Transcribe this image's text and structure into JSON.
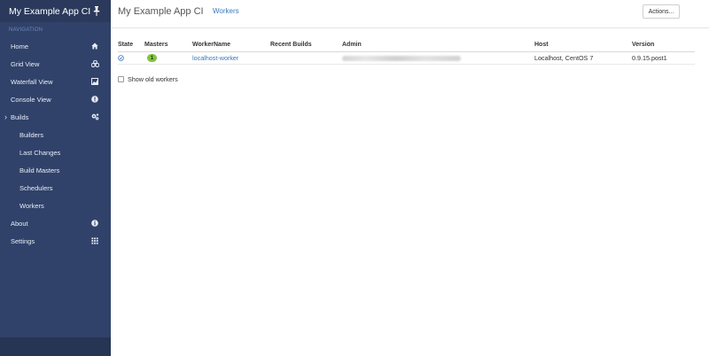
{
  "app": {
    "title": "My Example App CI"
  },
  "sidebar": {
    "section_label": "NAVIGATION",
    "items": [
      {
        "label": "Home",
        "icon": "home-icon"
      },
      {
        "label": "Grid View",
        "icon": "cubes-icon"
      },
      {
        "label": "Waterfall View",
        "icon": "area-chart-icon"
      },
      {
        "label": "Console View",
        "icon": "exclamation-circle-icon"
      },
      {
        "label": "Builds",
        "icon": "cogs-icon",
        "expanded": true
      },
      {
        "label": "Builders"
      },
      {
        "label": "Last Changes"
      },
      {
        "label": "Build Masters"
      },
      {
        "label": "Schedulers"
      },
      {
        "label": "Workers"
      },
      {
        "label": "About",
        "icon": "info-circle-icon"
      },
      {
        "label": "Settings",
        "icon": "grid-icon"
      }
    ],
    "expand_glyph": "›"
  },
  "header": {
    "breadcrumb": "Workers",
    "actions_label": "Actions..."
  },
  "table": {
    "headers": [
      "State",
      "Masters",
      "WorkerName",
      "Recent Builds",
      "Admin",
      "Host",
      "Version"
    ],
    "rows": [
      {
        "masters": "1",
        "worker_name": "localhost-worker",
        "recent_builds": "",
        "admin": "",
        "host": "Localhost, CentOS 7",
        "version": "0.9.15.post1"
      }
    ]
  },
  "show_old_workers": {
    "label": "Show old workers",
    "checked": false
  },
  "colors": {
    "sidebar_bg": "#30426a",
    "sidebar_header_bg": "#2b3a5c",
    "link": "#3a78b8",
    "badge": "#82c341"
  }
}
